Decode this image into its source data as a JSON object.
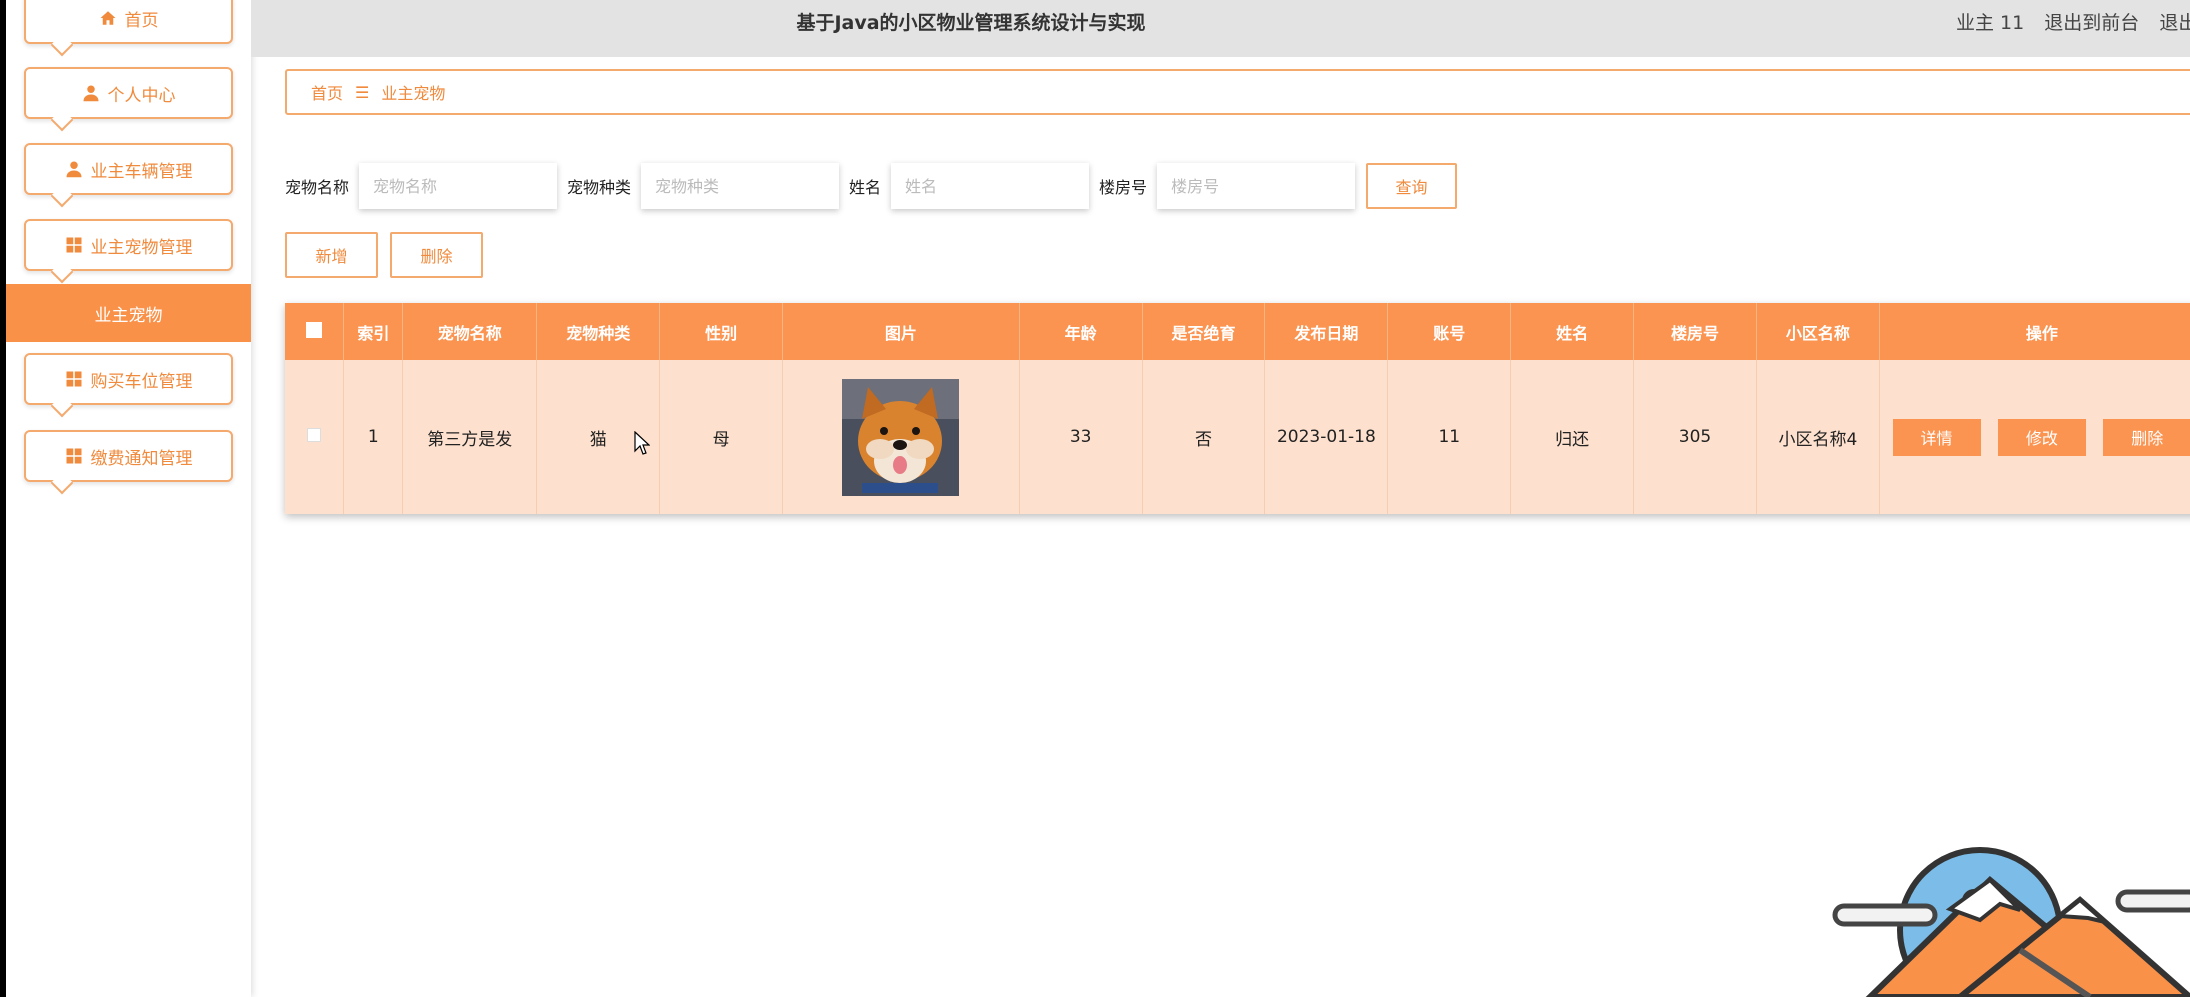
{
  "header": {
    "title": "基于Java的小区物业管理系统设计与实现",
    "user": "业主 11",
    "front": "退出到前台",
    "logout": "退出登"
  },
  "sidebar": {
    "items": [
      {
        "label": "首页",
        "icon": "home-icon"
      },
      {
        "label": "个人中心",
        "icon": "user-icon"
      },
      {
        "label": "业主车辆管理",
        "icon": "user-icon"
      },
      {
        "label": "业主宠物管理",
        "icon": "grid-icon"
      },
      {
        "label": "业主宠物",
        "active": true
      },
      {
        "label": "购买车位管理",
        "icon": "grid-icon"
      },
      {
        "label": "缴费通知管理",
        "icon": "grid-icon"
      }
    ]
  },
  "breadcrumb": {
    "home": "首页",
    "sep": "☰",
    "current": "业主宠物"
  },
  "search": {
    "fields": [
      {
        "label": "宠物名称",
        "placeholder": "宠物名称"
      },
      {
        "label": "宠物种类",
        "placeholder": "宠物种类"
      },
      {
        "label": "姓名",
        "placeholder": "姓名"
      },
      {
        "label": "楼房号",
        "placeholder": "楼房号"
      }
    ],
    "query": "查询"
  },
  "actions": {
    "add": "新增",
    "delete": "删除"
  },
  "table": {
    "columns": [
      "索引",
      "宠物名称",
      "宠物种类",
      "性别",
      "图片",
      "年龄",
      "是否绝育",
      "发布日期",
      "账号",
      "姓名",
      "楼房号",
      "小区名称",
      "操作"
    ],
    "rows": [
      {
        "index": "1",
        "name": "第三方是发",
        "type": "猫",
        "sex": "母",
        "age": "33",
        "neutered": "否",
        "date": "2023-01-18",
        "account": "11",
        "owner": "归还",
        "room": "305",
        "community": "小区名称4"
      }
    ],
    "ops": {
      "detail": "详情",
      "edit": "修改",
      "delete": "删除"
    }
  },
  "colors": {
    "accent": "#fb9451",
    "row": "#fde0cd",
    "border": "#f4a96d"
  }
}
